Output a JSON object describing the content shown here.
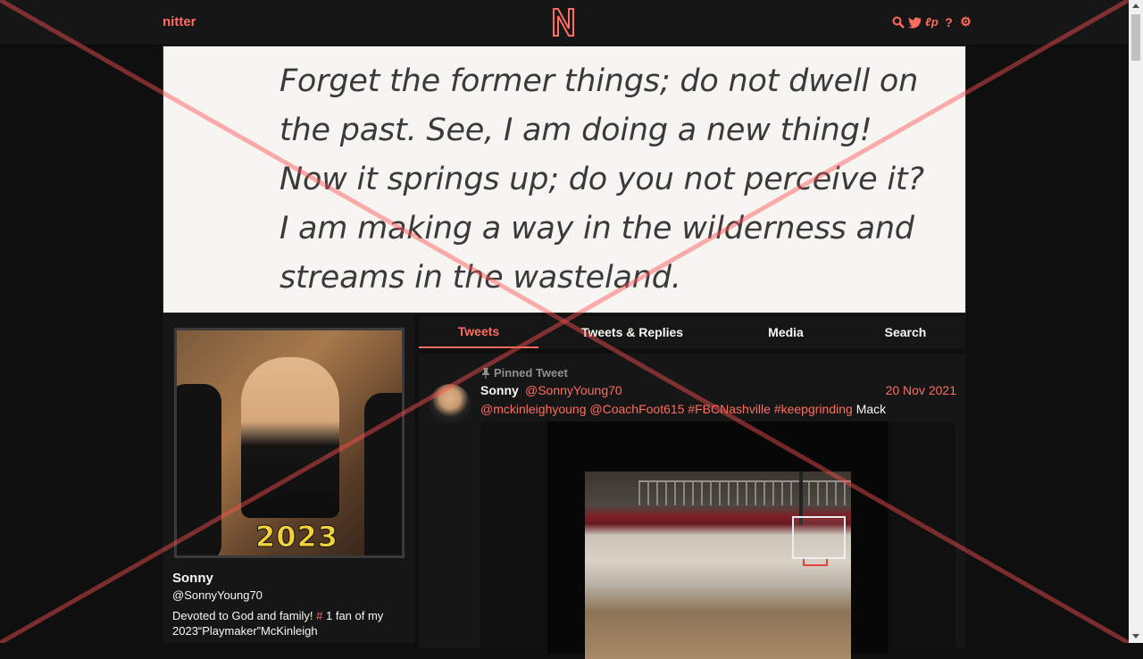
{
  "navbar": {
    "brand": "nitter",
    "logo_letter": "N",
    "icons": [
      "search-icon",
      "twitter-bird-icon",
      "rss-icon",
      "help-icon",
      "settings-gear-icon"
    ]
  },
  "banner": {
    "lines": [
      "Forget the former things; do not dwell on",
      "the past. See, I am doing a new thing!",
      "Now it springs up; do you not perceive it?",
      "I am making a way in the wilderness and",
      "streams in the wasteland."
    ]
  },
  "profile": {
    "avatar_year": "2023",
    "name": "Sonny",
    "handle": "@SonnyYoung70",
    "bio_part1": "Devoted to God and family! ",
    "bio_hash": "#",
    "bio_part2": " 1 fan of my 2023“Playmaker”McKinleigh"
  },
  "tabs": [
    {
      "label": "Tweets",
      "active": true
    },
    {
      "label": "Tweets & Replies",
      "active": false
    },
    {
      "label": "Media",
      "active": false
    },
    {
      "label": "Search",
      "active": false
    }
  ],
  "tweet": {
    "pinned_label": "Pinned Tweet",
    "name": "Sonny",
    "handle": "@SonnyYoung70",
    "date": "20 Nov 2021",
    "links": [
      "@mckinleighyoung",
      "@CoachFoot615",
      "#FBCNashville",
      "#keepgrinding"
    ],
    "tail": "Mack"
  },
  "colors": {
    "accent": "#ff6c60",
    "background": "#0f0f0f",
    "panel": "#161616",
    "banner_bg": "#f6f5f1"
  }
}
